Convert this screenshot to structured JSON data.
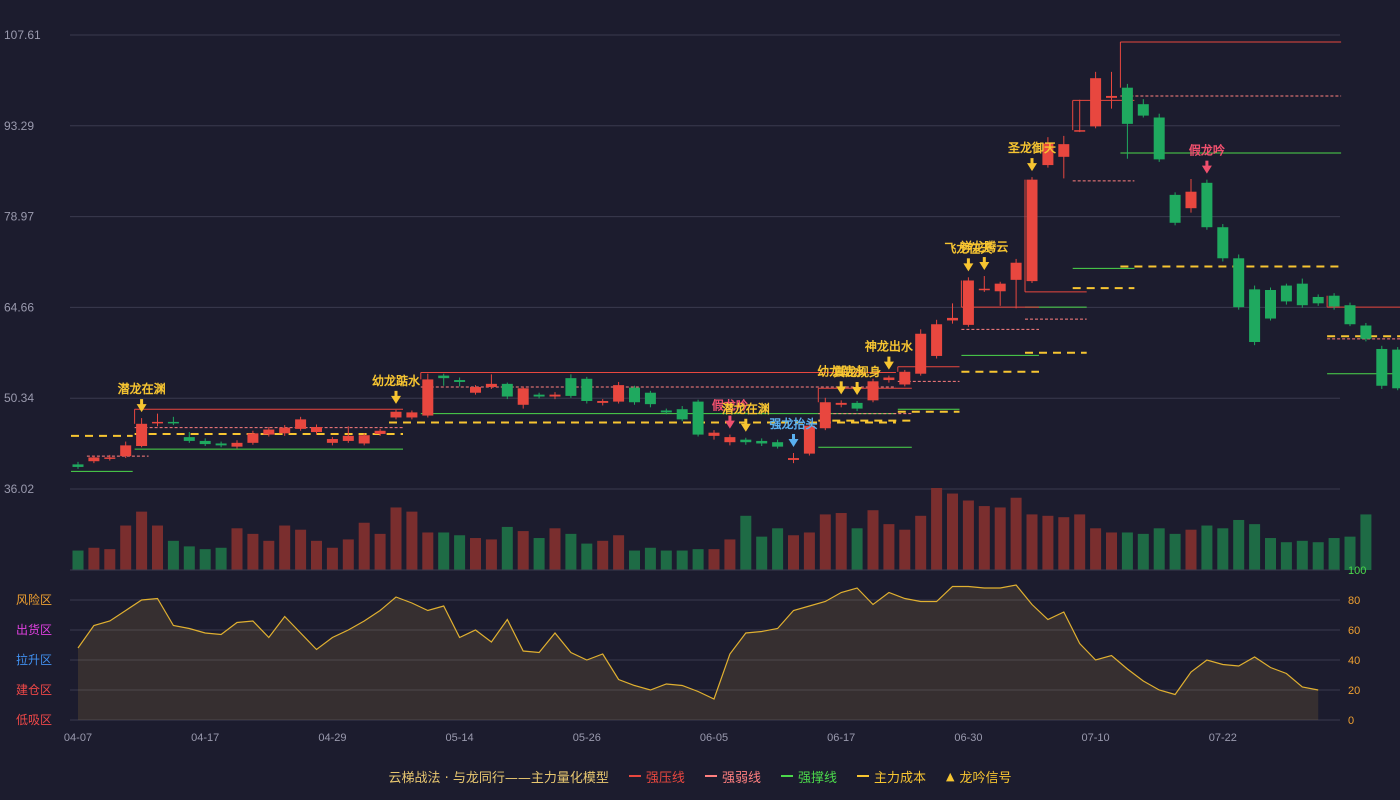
{
  "chart_data": [
    {
      "type": "candlestick",
      "x_ticks": [
        "04-07",
        "04-17",
        "04-29",
        "05-14",
        "05-26",
        "06-05",
        "06-17",
        "06-30",
        "07-10",
        "07-22"
      ],
      "y_ticks": [
        "107.61",
        "93.29",
        "78.97",
        "64.66",
        "50.34",
        "36.02"
      ],
      "ylim": [
        36.02,
        107.61
      ],
      "candles": [
        [
          39.9,
          39.5,
          40.3,
          39.2
        ],
        [
          40.4,
          41.0,
          41.3,
          40.1
        ],
        [
          40.8,
          41.0,
          41.4,
          40.5
        ],
        [
          41.2,
          42.9,
          43.5,
          40.9
        ],
        [
          42.8,
          46.3,
          47.2,
          42.6
        ],
        [
          46.5,
          46.6,
          47.9,
          45.9
        ],
        [
          46.6,
          46.4,
          47.4,
          46.1
        ],
        [
          44.2,
          43.6,
          45.0,
          43.3
        ],
        [
          43.6,
          43.1,
          44.0,
          42.8
        ],
        [
          43.2,
          42.9,
          43.5,
          42.6
        ],
        [
          42.7,
          43.3,
          43.7,
          42.4
        ],
        [
          43.3,
          44.8,
          45.2,
          43.0
        ],
        [
          44.6,
          45.4,
          45.8,
          44.3
        ],
        [
          44.8,
          45.7,
          46.1,
          44.4
        ],
        [
          45.5,
          47.0,
          47.4,
          45.2
        ],
        [
          45.0,
          45.8,
          46.2,
          44.6
        ],
        [
          43.3,
          43.9,
          44.2,
          42.9
        ],
        [
          43.6,
          44.4,
          45.9,
          43.3
        ],
        [
          43.2,
          44.5,
          44.8,
          42.9
        ],
        [
          44.7,
          45.2,
          45.5,
          44.4
        ],
        [
          47.3,
          48.2,
          48.5,
          47.0
        ],
        [
          47.3,
          48.1,
          48.4,
          47.0
        ],
        [
          47.6,
          53.3,
          54.2,
          47.3
        ],
        [
          53.9,
          53.5,
          54.2,
          52.3
        ],
        [
          53.2,
          52.9,
          53.6,
          52.2
        ],
        [
          51.2,
          52.1,
          52.4,
          50.9
        ],
        [
          52.1,
          52.6,
          54.1,
          51.8
        ],
        [
          52.6,
          50.6,
          52.8,
          50.2
        ],
        [
          49.3,
          51.9,
          52.2,
          48.7
        ],
        [
          50.9,
          50.6,
          51.2,
          50.3
        ],
        [
          50.6,
          50.9,
          51.3,
          50.2
        ],
        [
          53.5,
          50.7,
          54.1,
          50.4
        ],
        [
          53.4,
          49.9,
          53.7,
          49.5
        ],
        [
          49.6,
          49.9,
          50.2,
          49.2
        ],
        [
          49.8,
          52.4,
          52.9,
          49.5
        ],
        [
          52.0,
          49.7,
          52.3,
          49.3
        ],
        [
          51.2,
          49.4,
          51.5,
          48.9
        ],
        [
          48.4,
          48.1,
          48.7,
          47.8
        ],
        [
          48.6,
          47.0,
          49.1,
          46.7
        ],
        [
          49.8,
          44.6,
          50.1,
          44.3
        ],
        [
          44.4,
          44.9,
          45.3,
          43.8
        ],
        [
          43.4,
          44.2,
          44.6,
          42.9
        ],
        [
          43.8,
          43.4,
          44.1,
          43.0
        ],
        [
          43.6,
          43.2,
          44.0,
          42.8
        ],
        [
          43.4,
          42.7,
          43.8,
          42.4
        ],
        [
          40.6,
          40.9,
          41.7,
          40.1
        ],
        [
          41.6,
          46.0,
          46.5,
          41.3
        ],
        [
          45.6,
          49.7,
          50.4,
          45.3
        ],
        [
          49.3,
          49.6,
          50.0,
          48.9
        ],
        [
          49.6,
          48.7,
          49.9,
          48.3
        ],
        [
          50.0,
          53.0,
          53.4,
          49.7
        ],
        [
          53.2,
          53.6,
          53.9,
          52.8
        ],
        [
          52.5,
          54.5,
          54.8,
          52.2
        ],
        [
          54.2,
          60.5,
          61.2,
          53.9
        ],
        [
          57.0,
          62.0,
          62.7,
          56.6
        ],
        [
          62.6,
          63.0,
          65.3,
          62.1
        ],
        [
          61.9,
          68.9,
          69.4,
          61.6
        ],
        [
          67.5,
          67.6,
          69.6,
          67.1
        ],
        [
          67.2,
          68.4,
          68.7,
          64.9
        ],
        [
          69.0,
          71.7,
          72.3,
          64.5
        ],
        [
          68.8,
          84.8,
          85.2,
          68.5
        ],
        [
          87.1,
          90.5,
          91.5,
          86.7
        ],
        [
          88.4,
          90.4,
          91.7,
          85.0
        ],
        [
          92.6,
          92.6,
          97.4,
          92.3
        ],
        [
          93.2,
          100.8,
          101.8,
          92.9
        ],
        [
          97.7,
          98.0,
          101.8,
          96.0
        ],
        [
          99.3,
          93.6,
          99.9,
          88.1
        ],
        [
          96.7,
          94.9,
          97.5,
          94.6
        ],
        [
          94.6,
          88.0,
          95.2,
          87.6
        ],
        [
          82.4,
          78.0,
          82.8,
          77.6
        ],
        [
          80.3,
          82.9,
          84.9,
          79.6
        ],
        [
          84.3,
          77.3,
          84.8,
          76.9
        ],
        [
          77.3,
          72.4,
          77.8,
          71.9
        ],
        [
          72.4,
          64.7,
          73.0,
          64.3
        ],
        [
          67.5,
          59.2,
          68.1,
          58.7
        ],
        [
          67.4,
          62.9,
          67.8,
          62.6
        ],
        [
          68.1,
          65.6,
          68.4,
          65.1
        ],
        [
          68.4,
          65.0,
          69.2,
          64.6
        ],
        [
          66.3,
          65.3,
          66.7,
          64.9
        ],
        [
          66.5,
          64.8,
          66.9,
          64.3
        ],
        [
          65.0,
          62.0,
          65.4,
          61.7
        ],
        [
          61.8,
          59.7,
          62.2,
          59.3
        ],
        [
          58.1,
          52.3,
          58.6,
          51.8
        ],
        [
          58.0,
          51.9,
          58.4,
          51.6
        ]
      ],
      "pressure_lines": [
        [
          4,
          20,
          48.6
        ],
        [
          22,
          51,
          54.4
        ],
        [
          47,
          52,
          51.9
        ],
        [
          52,
          55,
          55.3
        ],
        [
          56,
          60,
          64.7
        ],
        [
          60,
          63,
          67.1
        ],
        [
          63,
          66,
          97.3
        ],
        [
          66,
          79,
          106.5
        ],
        [
          79,
          85,
          64.7
        ]
      ],
      "weak_lines": [
        [
          1,
          4,
          41.2
        ],
        [
          4,
          20,
          45.7
        ],
        [
          22,
          51,
          52.1
        ],
        [
          47,
          52,
          47.9
        ],
        [
          52,
          55,
          53.0
        ],
        [
          56,
          60,
          61.2
        ],
        [
          60,
          63,
          62.8
        ],
        [
          63,
          66,
          84.6
        ],
        [
          66,
          79,
          98.0
        ],
        [
          79,
          85,
          59.7
        ]
      ],
      "support_lines": [
        [
          0,
          3,
          38.8
        ],
        [
          4,
          20,
          42.3
        ],
        [
          22,
          51,
          47.9
        ],
        [
          47,
          52,
          42.6
        ],
        [
          52,
          55,
          48.6
        ],
        [
          56,
          60,
          57.1
        ],
        [
          60,
          63,
          64.7
        ],
        [
          63,
          66,
          70.8
        ],
        [
          66,
          79,
          89.0
        ],
        [
          79,
          85,
          54.2
        ]
      ],
      "cost_lines": [
        [
          0,
          3,
          44.4
        ],
        [
          4,
          20,
          44.7
        ],
        [
          20,
          51,
          46.5
        ],
        [
          47,
          52,
          46.8
        ],
        [
          52,
          55,
          48.2
        ],
        [
          56,
          60,
          54.5
        ],
        [
          60,
          63,
          57.5
        ],
        [
          63,
          66,
          67.7
        ],
        [
          66,
          79,
          71.1
        ],
        [
          79,
          85,
          60.1
        ]
      ],
      "signals": [
        {
          "i": 4,
          "label": "潜龙在渊",
          "kind": "gold"
        },
        {
          "i": 20,
          "label": "幼龙踮水",
          "kind": "gold"
        },
        {
          "i": 41,
          "label": "假龙吟",
          "kind": "red"
        },
        {
          "i": 42,
          "label": "潜龙在渊",
          "kind": "gold"
        },
        {
          "i": 45,
          "label": "强龙抬头",
          "kind": "blue"
        },
        {
          "i": 48,
          "label": "幼龙踮水",
          "kind": "gold"
        },
        {
          "i": 49,
          "label": "真龙现身",
          "kind": "gold"
        },
        {
          "i": 51,
          "label": "神龙出水",
          "kind": "gold"
        },
        {
          "i": 56,
          "label": "飞龙在天",
          "kind": "gold"
        },
        {
          "i": 57,
          "label": "祥龙腾云",
          "kind": "gold"
        },
        {
          "i": 60,
          "label": "圣龙御天",
          "kind": "gold"
        },
        {
          "i": 71,
          "label": "假龙吟",
          "kind": "red"
        }
      ]
    },
    {
      "type": "bar",
      "name": "volume",
      "values": [
        14,
        16,
        15,
        32,
        42,
        32,
        21,
        17,
        15,
        16,
        30,
        26,
        21,
        32,
        29,
        21,
        16,
        22,
        34,
        26,
        45,
        42,
        27,
        27,
        25,
        23,
        22,
        31,
        28,
        23,
        30,
        26,
        19,
        21,
        25,
        14,
        16,
        14,
        14,
        15,
        15,
        22,
        39,
        24,
        30,
        25,
        27,
        40,
        41,
        30,
        43,
        33,
        29,
        39,
        59,
        55,
        50,
        46,
        45,
        52,
        40,
        39,
        38,
        40,
        30,
        27,
        27,
        26,
        30,
        26,
        29,
        32,
        30,
        36,
        33,
        23,
        20,
        21,
        20,
        23,
        24,
        40
      ]
    },
    {
      "type": "area",
      "name": "dragon_index",
      "ylim": [
        0,
        100
      ],
      "y_ticks": [
        "100",
        "80",
        "60",
        "40",
        "20",
        "0"
      ],
      "zones": [
        "风险区",
        "出货区",
        "拉升区",
        "建仓区",
        "低吸区"
      ],
      "values": [
        48,
        63,
        66,
        73,
        80,
        81,
        63,
        61,
        58,
        57,
        65,
        66,
        55,
        69,
        58,
        47,
        55,
        60,
        66,
        73,
        82,
        78,
        73,
        76,
        55,
        60,
        52,
        67,
        46,
        45,
        58,
        45,
        40,
        44,
        27,
        23,
        20,
        24,
        23,
        19,
        14,
        44,
        58,
        59,
        61,
        73,
        76,
        79,
        85,
        88,
        77,
        85,
        81,
        79,
        79,
        89,
        89,
        88,
        88,
        90,
        77,
        67,
        72,
        51,
        40,
        43,
        34,
        26,
        20,
        17,
        32,
        40,
        37,
        36,
        42,
        35,
        31,
        22,
        20
      ]
    }
  ],
  "legend": {
    "title": "云梯战法 · 与龙同行——主力量化模型",
    "items": [
      "强压线",
      "强弱线",
      "强撑线",
      "主力成本",
      "龙吟信号"
    ]
  },
  "colors": {
    "background": "#1c1c2e",
    "up": "#e8473f",
    "down": "#1fa95f",
    "pressure": "#e8473f",
    "weak": "#ff7f7f",
    "support": "#4bd84b",
    "cost": "#f7c531",
    "signal_gold": "#f7c531",
    "signal_red": "#f0506e",
    "signal_blue": "#5ab0f0",
    "label": "#e8c770",
    "zone_risk": "#f0a030",
    "zone_exit": "#e040e0",
    "zone_up": "#4090f0",
    "zone_build": "#f04848",
    "zone_low": "#f04848"
  }
}
